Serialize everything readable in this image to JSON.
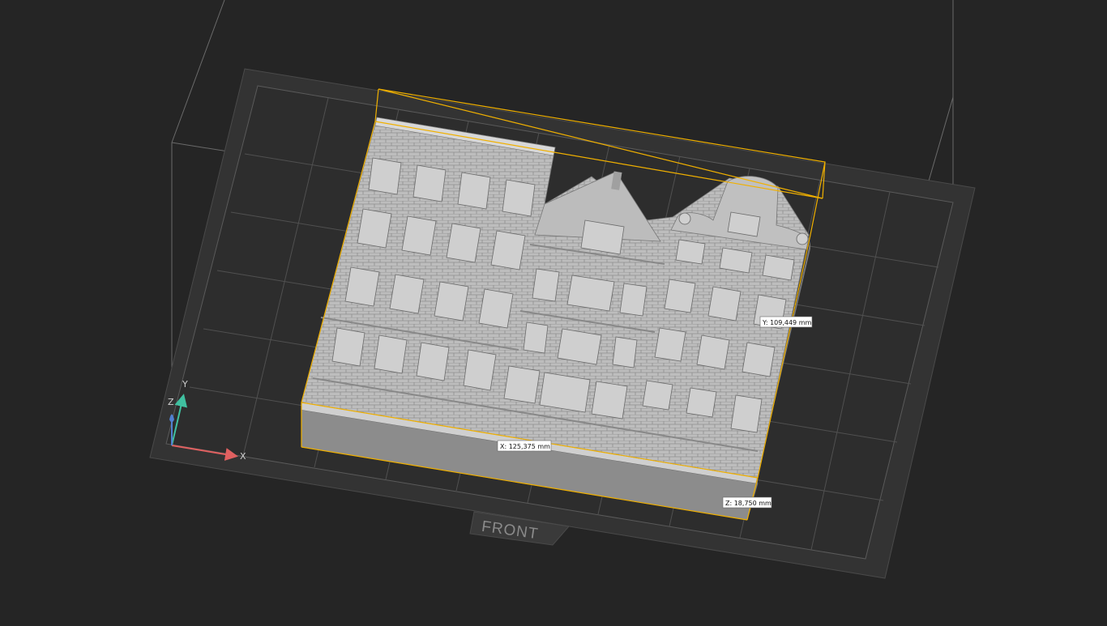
{
  "viewport": {
    "background_color": "#252525",
    "bed_color": "#333333",
    "grid_color": "#555555",
    "selection_color": "#f0b000",
    "model_color": "#b8b8b8"
  },
  "bed": {
    "front_label": "FRONT"
  },
  "dimensions": {
    "x_label": "X: 125,375 mm",
    "y_label": "Y: 109,449 mm",
    "z_label": "Z: 18,750 mm"
  },
  "axes": {
    "x": "X",
    "y": "Y",
    "z": "Z",
    "x_color": "#e06060",
    "y_color": "#40c0a0",
    "z_color": "#5080d0"
  }
}
